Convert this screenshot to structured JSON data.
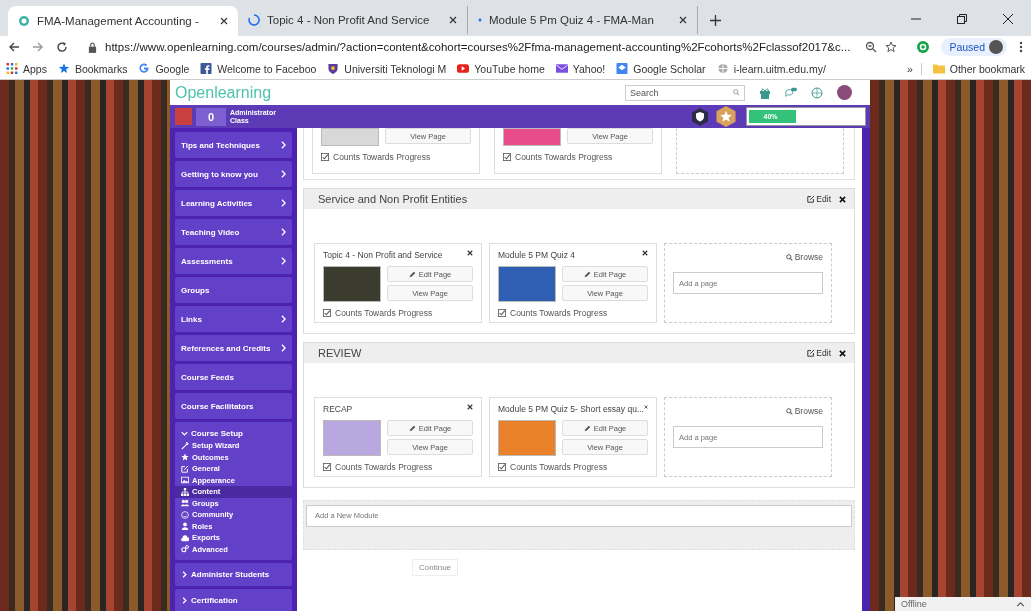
{
  "browser": {
    "tabs": [
      {
        "title": "FMA-Management Accounting -",
        "selected": true
      },
      {
        "title": "Topic 4 - Non Profit And Service",
        "selected": false
      },
      {
        "title": "Module 5 Pm Quiz 4 - FMA-Man",
        "selected": false
      }
    ],
    "url": "https://www.openlearning.com/courses/admin/?action=content&cohort=courses%2Ffma-management-accounting%2Fcohorts%2Fclassof2017&c...",
    "profile_label": "Paused",
    "bookmarks": [
      {
        "label": "Apps"
      },
      {
        "label": "Bookmarks"
      },
      {
        "label": "Google"
      },
      {
        "label": "Welcome to Faceboo"
      },
      {
        "label": "Universiti Teknologi M"
      },
      {
        "label": "YouTube home"
      },
      {
        "label": "Yahoo!"
      },
      {
        "label": "Google Scholar"
      },
      {
        "label": "i-learn.uitm.edu.my/"
      }
    ],
    "more_bookmarks": "»",
    "other_bookmarks": "Other bookmark"
  },
  "site": {
    "logo": "Openlearning",
    "search": {
      "placeholder": "Search"
    }
  },
  "user_bar": {
    "points": "0",
    "role": "Administrator",
    "group": "Class",
    "progress": {
      "level": 0.4,
      "reading": "40%"
    }
  },
  "sidebar": {
    "items": [
      {
        "label": "Tips and Techniques",
        "has_submenu": true
      },
      {
        "label": "Getting to know you",
        "has_submenu": true
      },
      {
        "label": "Learning Activities",
        "has_submenu": true
      },
      {
        "label": "Teaching Video",
        "has_submenu": true
      },
      {
        "label": "Assessments",
        "has_submenu": true
      },
      {
        "label": "Groups",
        "has_submenu": false
      },
      {
        "label": "Links",
        "has_submenu": true
      },
      {
        "label": "References and Credits",
        "has_submenu": true
      },
      {
        "label": "Course Feeds",
        "has_submenu": false
      },
      {
        "label": "Course Facilitators",
        "has_submenu": false
      }
    ],
    "sections": [
      {
        "label": "Course Setup",
        "expanded": true,
        "children": [
          {
            "label": "Setup Wizard",
            "selected": false
          },
          {
            "label": "Outcomes",
            "selected": false
          },
          {
            "label": "General",
            "selected": false
          },
          {
            "label": "Appearance",
            "selected": false
          },
          {
            "label": "Content",
            "selected": true
          },
          {
            "label": "Groups",
            "selected": false
          },
          {
            "label": "Community",
            "selected": false
          },
          {
            "label": "Roles",
            "selected": false
          },
          {
            "label": "Exports",
            "selected": false
          },
          {
            "label": "Advanced",
            "selected": false
          }
        ]
      },
      {
        "label": "Administer Students",
        "expanded": false
      },
      {
        "label": "Certification",
        "expanded": false
      }
    ]
  },
  "previous_module": {
    "pages": [
      {
        "color": "#d8d8d8",
        "view_button": "View Page",
        "counts_label": "Counts Towards Progress",
        "counts": true
      },
      {
        "color": "#e84c8a",
        "view_button": "View Page",
        "counts_label": "Counts Towards Progress",
        "counts": true
      }
    ]
  },
  "modules": [
    {
      "title": "Service and Non Profit Entities",
      "edit_label": "Edit",
      "pages": [
        {
          "title": "Topic 4 - Non Profit and Service",
          "color": "#3b3b2e",
          "edit_button": "Edit Page",
          "view_button": "View Page",
          "counts_label": "Counts Towards Progress",
          "counts": true
        },
        {
          "title": "Module 5 PM Quiz 4",
          "color": "#2f5fb3",
          "edit_button": "Edit Page",
          "view_button": "View Page",
          "counts_label": "Counts Towards Progress",
          "counts": true
        }
      ],
      "browse_label": "Browse",
      "add_page": {
        "placeholder": "Add a page"
      }
    },
    {
      "title": "REVIEW",
      "edit_label": "Edit",
      "pages": [
        {
          "title": "RECAP",
          "color": "#b9a7e0",
          "edit_button": "Edit Page",
          "view_button": "View Page",
          "counts_label": "Counts Towards Progress",
          "counts": true
        },
        {
          "title": "Module 5 PM Quiz 5- Short essay qu...",
          "color": "#e8812a",
          "edit_button": "Edit Page",
          "view_button": "View Page",
          "counts_label": "Counts Towards Progress",
          "counts": true
        }
      ],
      "browse_label": "Browse",
      "add_page": {
        "placeholder": "Add a page"
      }
    }
  ],
  "new_module": {
    "placeholder": "Add a New Module"
  },
  "continue_button": "Continue",
  "chat": {
    "status": "Offline"
  }
}
